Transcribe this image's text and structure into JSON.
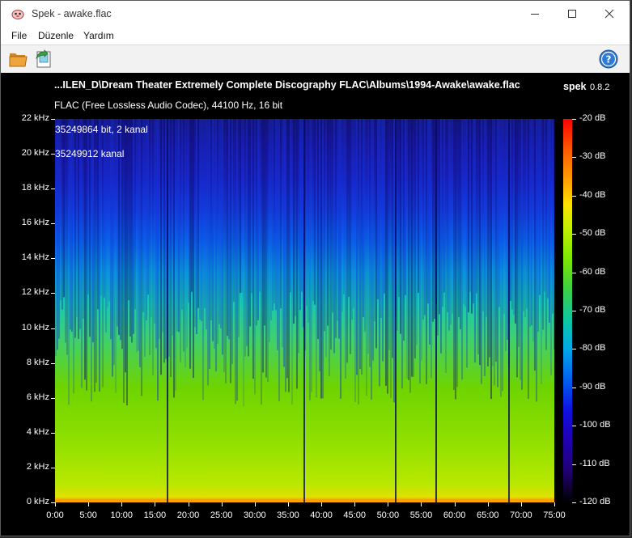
{
  "window": {
    "title": "Spek - awake.flac",
    "controls": [
      "minimize",
      "maximize",
      "close"
    ]
  },
  "menu": [
    "File",
    "Düzenle",
    "Yardım"
  ],
  "toolbar": {
    "open_icon": "folder-open-icon",
    "save_icon": "save-export-icon",
    "help_icon": "help-icon"
  },
  "header": {
    "file_path": "...ILEN_D\\Dream Theater Extremely Complete Discography FLAC\\Albums\\1994-Awake\\awake.flac",
    "app_name": "spek",
    "version": "0.8.2",
    "codec_info": "FLAC (Free Lossless Audio Codec), 44100 Hz, 16 bit"
  },
  "overlay": {
    "line1": "35249864 bit, 2 kanal",
    "line2": "35249912 kanal"
  },
  "chart_data": {
    "type": "heatmap",
    "y_axis": {
      "ticks": [
        "0 kHz",
        "2 kHz",
        "4 kHz",
        "6 kHz",
        "8 kHz",
        "10 kHz",
        "12 kHz",
        "14 kHz",
        "16 kHz",
        "18 kHz",
        "20 kHz",
        "22 kHz"
      ],
      "range": [
        0,
        22
      ]
    },
    "x_axis": {
      "ticks": [
        "0:00",
        "5:00",
        "10:00",
        "15:00",
        "20:00",
        "25:00",
        "30:00",
        "35:00",
        "40:00",
        "45:00",
        "50:00",
        "55:00",
        "60:00",
        "65:00",
        "70:00",
        "75:00"
      ],
      "range_minutes": [
        0,
        75
      ]
    },
    "colorbar": {
      "ticks": [
        "-20 dB",
        "-30 dB",
        "-40 dB",
        "-50 dB",
        "-60 dB",
        "-70 dB",
        "-80 dB",
        "-90 dB",
        "-100 dB",
        "-110 dB",
        "-120 dB"
      ],
      "range_db": [
        -120,
        -20
      ]
    }
  },
  "colors": {
    "background": "#000000",
    "title_bar": "#ffffff",
    "toolbar": "#f2f2f2"
  }
}
